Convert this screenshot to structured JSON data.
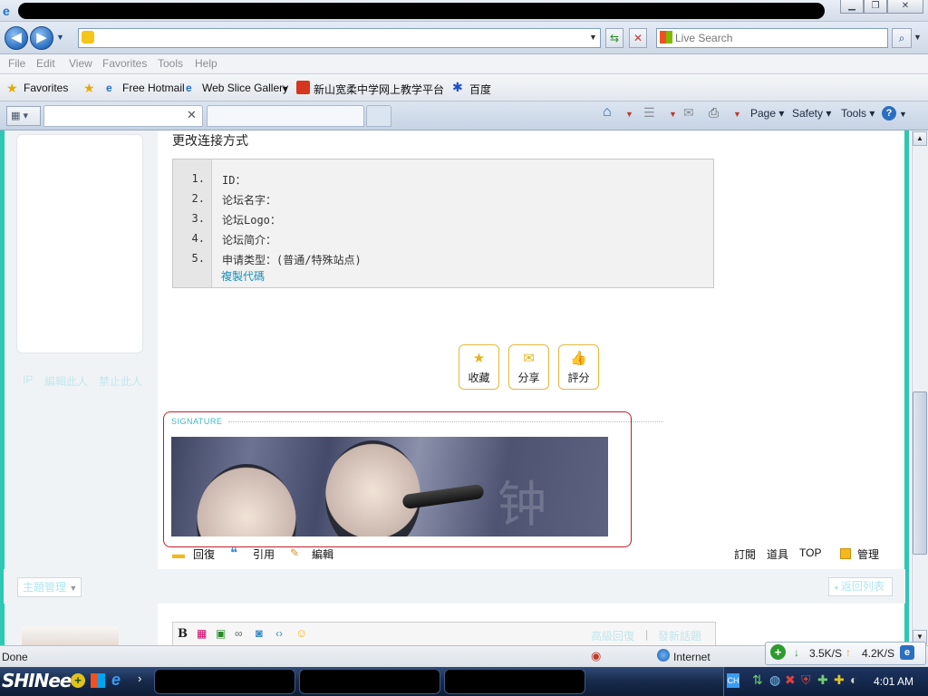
{
  "browser": {
    "menu": [
      "File",
      "Edit",
      "View",
      "Favorites",
      "Tools",
      "Help"
    ],
    "search_placeholder": "Live Search",
    "favorites_label": "Favorites",
    "favorites_bar": [
      "Free Hotmail",
      "Web Slice Gallery",
      "新山宽柔中学网上教学平台",
      "百度"
    ],
    "commands": [
      "Page",
      "Safety",
      "Tools"
    ],
    "status_text": "Done",
    "zone_label": "Internet",
    "net_down": "3.5K/S",
    "net_up": "4.2K/S"
  },
  "page": {
    "left_links": [
      "IP",
      "編輯此人",
      "禁止此人"
    ],
    "heading": "更改连接方式",
    "code_lines": [
      {
        "num": "1.",
        "text": "ID："
      },
      {
        "num": "2.",
        "text": "论坛名字："
      },
      {
        "num": "3.",
        "text": "论坛Logo："
      },
      {
        "num": "4.",
        "text": "论坛简介："
      },
      {
        "num": "5.",
        "text": "申请类型：(普通/特殊站点)"
      }
    ],
    "copy_code": "複製代碼",
    "actions": [
      "收藏",
      "分享",
      "評分"
    ],
    "signature_label": "SIGNATURE",
    "post_actions_left": [
      "回復",
      "引用",
      "編輯"
    ],
    "post_actions_right": [
      "訂閱",
      "道具",
      "TOP",
      "管理"
    ],
    "topic_manage": "主題管理",
    "back_to_list": "返回列表",
    "editor_links": [
      "高級回復",
      "發新話題"
    ]
  },
  "taskbar": {
    "start_label": "SHINee",
    "clock": "4:01 AM"
  }
}
